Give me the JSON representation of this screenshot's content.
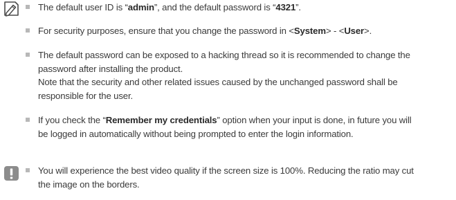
{
  "note": {
    "icon": "note-pencil-icon",
    "items": [
      {
        "t1": "The default user ID is “",
        "b1": "admin",
        "t2": "”, and the default password is “",
        "b2": "4321",
        "t3": "”."
      },
      {
        "t1": "For security purposes, ensure that you change the password in <",
        "b1": "System",
        "t2": "> - <",
        "b2": "User",
        "t3": ">."
      },
      {
        "line1": "The default password can be exposed to a hacking thread so it is recommended to change the",
        "line2": "password after installing the product.",
        "line3": "Note that the security and other related issues caused by the unchanged password shall be",
        "line4": "responsible for the user."
      },
      {
        "t1": "If you check the “",
        "b1": "Remember my credentials",
        "t2": "” option when your input is done, in future you will",
        "line2": "be logged in automatically without being prompted to enter the login information."
      }
    ]
  },
  "caution": {
    "icon": "exclamation-icon",
    "accent_color": "#8c8c8c",
    "items": [
      {
        "line1": "You will experience the best video quality if the screen size is 100%. Reducing the ratio may cut",
        "line2": "the image on the borders."
      }
    ]
  }
}
